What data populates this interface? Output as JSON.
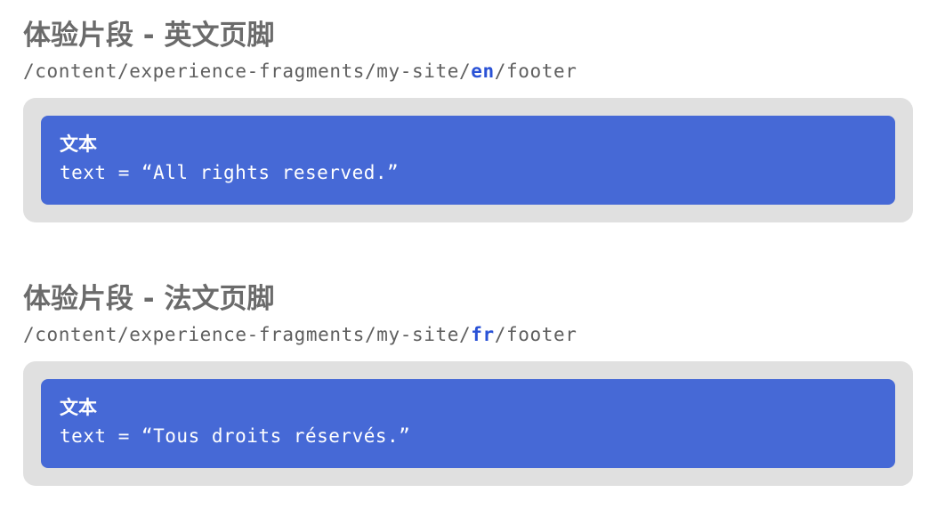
{
  "fragments": [
    {
      "heading": "体验片段 - 英文页脚",
      "path_prefix": "/content/experience-fragments/my-site/",
      "path_lang": "en",
      "path_suffix": "/footer",
      "component_title": "文本",
      "component_prop": "text = “All rights reserved.”"
    },
    {
      "heading": "体验片段 - 法文页脚",
      "path_prefix": "/content/experience-fragments/my-site/",
      "path_lang": "fr",
      "path_suffix": "/footer",
      "component_title": "文本",
      "component_prop": "text = “Tous droits réservés.”"
    }
  ],
  "colors": {
    "heading": "#6b6b6b",
    "path": "#5f5f5f",
    "lang_highlight": "#2a52d6",
    "container": "#e0e0e0",
    "component": "#4669d6",
    "component_text": "#ffffff"
  }
}
